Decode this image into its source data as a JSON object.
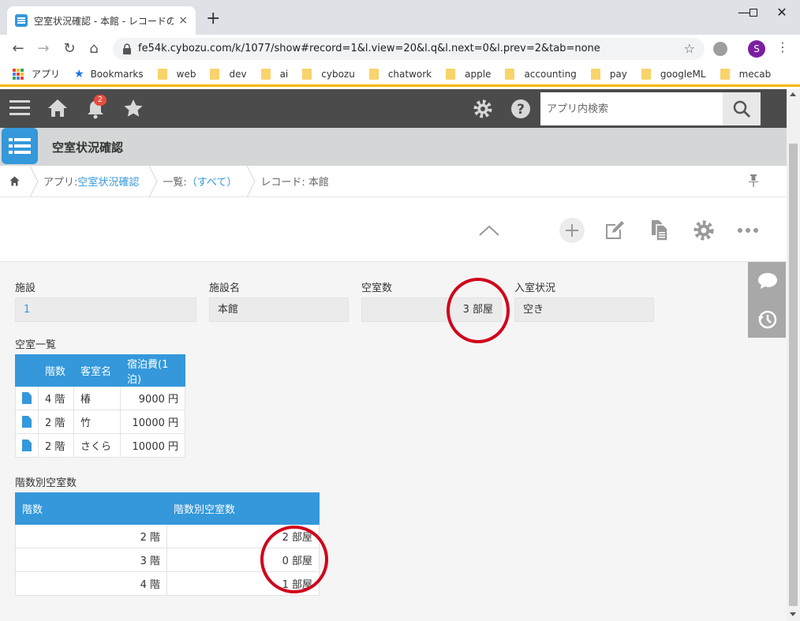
{
  "browser": {
    "tab_title": "空室状況確認 - 本館 - レコードの詳",
    "tab_close": "×",
    "new_tab": "+",
    "url": "fe54k.cybozu.com/k/1077/show#record=1&l.view=20&l.q&l.next=0&l.prev=2&tab=none",
    "avatar_letter": "S",
    "bookmarks": [
      "アプリ",
      "Bookmarks",
      "web",
      "dev",
      "ai",
      "cybozu",
      "chatwork",
      "apple",
      "accounting",
      "pay",
      "googleML",
      "mecab"
    ]
  },
  "kintone": {
    "notification_count": "2",
    "search_placeholder": "アプリ内検索",
    "app_name": "空室状況確認",
    "breadcrumb": {
      "app_prefix": "アプリ: ",
      "app_link": "空室状況確認",
      "view_prefix": "一覧: ",
      "view_link": "（すべて）",
      "record": "レコード: 本館"
    }
  },
  "record": {
    "fields": {
      "facility_label": "施設",
      "facility_value": "1",
      "facility_name_label": "施設名",
      "facility_name_value": "本館",
      "vacancy_label": "空室数",
      "vacancy_value": "3 部屋",
      "status_label": "入室状況",
      "status_value": "空き"
    },
    "vacancy_list": {
      "label": "空室一覧",
      "headers": [
        "階数",
        "客室名",
        "宿泊費(1泊)"
      ],
      "rows": [
        {
          "floor": "4 階",
          "room": "椿",
          "price": "9000 円"
        },
        {
          "floor": "2 階",
          "room": "竹",
          "price": "10000 円"
        },
        {
          "floor": "2 階",
          "room": "さくら",
          "price": "10000 円"
        }
      ]
    },
    "floor_vacancy": {
      "label": "階数別空室数",
      "headers": [
        "階数",
        "階数別空室数"
      ],
      "rows": [
        {
          "floor": "2 階",
          "count": "2 部屋"
        },
        {
          "floor": "3 階",
          "count": "0 部屋"
        },
        {
          "floor": "4 階",
          "count": "1 部屋"
        }
      ]
    }
  },
  "colors": {
    "accent": "#3498db",
    "header_bg": "#4b4b4b",
    "annotation_red": "#d0021b"
  }
}
